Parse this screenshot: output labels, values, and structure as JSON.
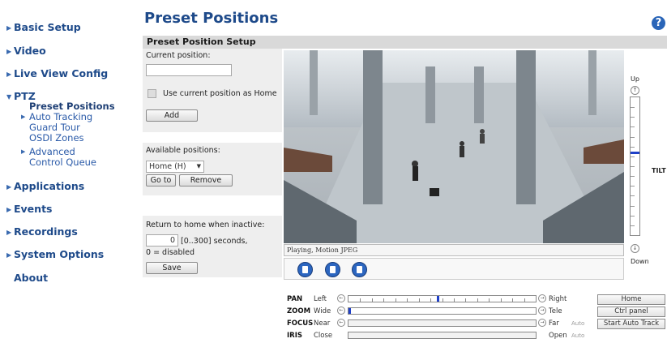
{
  "sidebar": {
    "items": [
      {
        "label": "Basic Setup"
      },
      {
        "label": "Video"
      },
      {
        "label": "Live View Config"
      },
      {
        "label": "PTZ"
      },
      {
        "label": "Applications"
      },
      {
        "label": "Events"
      },
      {
        "label": "Recordings"
      },
      {
        "label": "System Options"
      },
      {
        "label": "About"
      }
    ],
    "ptz_sub": [
      {
        "label": "Preset Positions"
      },
      {
        "label": "Auto Tracking"
      },
      {
        "label": "Guard Tour"
      },
      {
        "label": "OSDI Zones"
      },
      {
        "label": "Advanced"
      },
      {
        "label": "Control Queue"
      }
    ]
  },
  "header": {
    "title": "Preset Positions",
    "help": "?"
  },
  "section": {
    "title": "Preset Position Setup"
  },
  "form": {
    "current_position_label": "Current position:",
    "current_position_value": "",
    "use_home_label": "Use current position as Home",
    "add_label": "Add",
    "available_label": "Available positions:",
    "available_selected": "Home (H)",
    "goto_label": "Go to",
    "remove_label": "Remove",
    "return_label": "Return to home when inactive:",
    "return_value": "0",
    "return_unit": "[0..300] seconds,",
    "disabled_note": "0 = disabled",
    "save_label": "Save"
  },
  "video": {
    "status": "Playing, Motion JPEG"
  },
  "tilt": {
    "up": "Up",
    "down": "Down",
    "label": "TILT",
    "level": 0.4
  },
  "ptz_controls": {
    "pan": {
      "label": "PAN",
      "min": "Left",
      "max": "Right",
      "level": 0.48
    },
    "zoom": {
      "label": "ZOOM",
      "min": "Wide",
      "max": "Tele",
      "level": 0.0
    },
    "focus": {
      "label": "FOCUS",
      "min": "Near",
      "max": "Far",
      "auto": "Auto"
    },
    "iris": {
      "label": "IRIS",
      "min": "Close",
      "max": "Open",
      "auto": "Auto"
    }
  },
  "right_buttons": {
    "home": "Home",
    "ctrl_panel": "Ctrl panel",
    "auto_track": "Start Auto Track"
  },
  "colors": {
    "nav": "#1e4a8a",
    "accent": "#2c66c0",
    "panel": "#eeeeee"
  }
}
